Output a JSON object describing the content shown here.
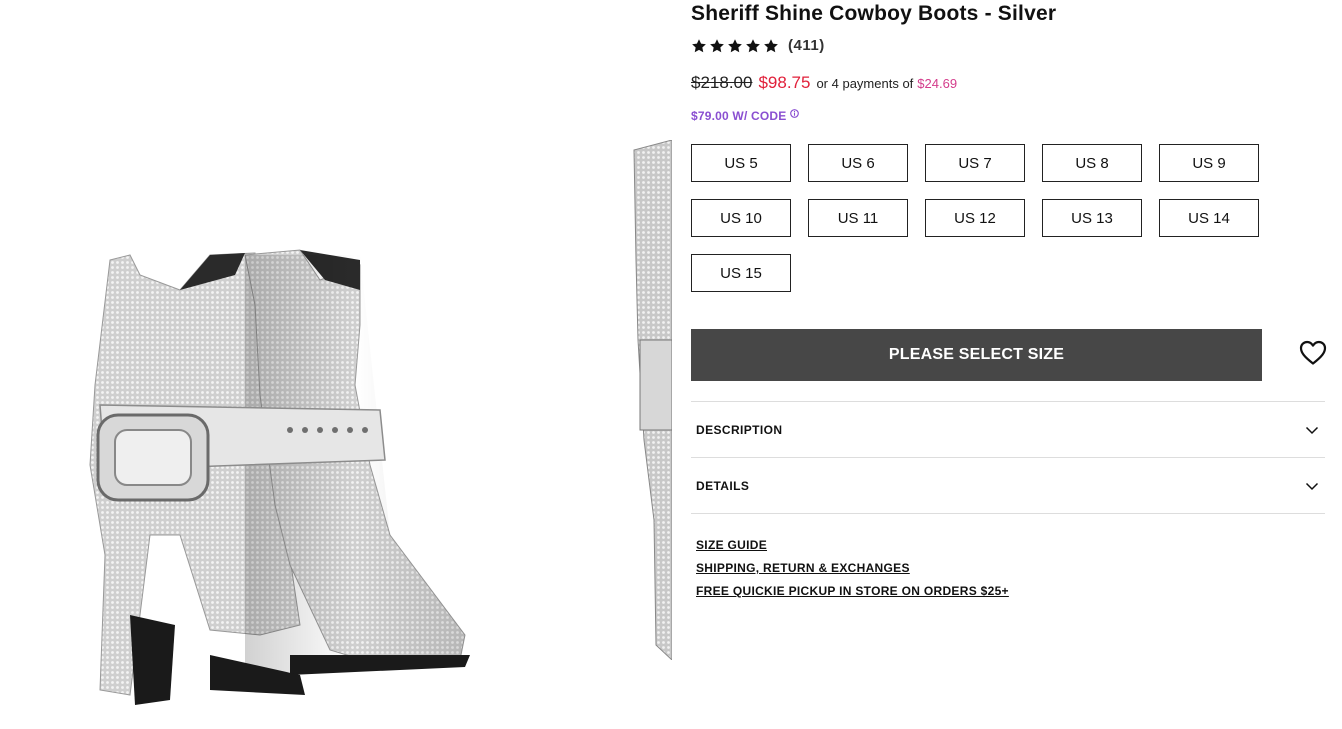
{
  "product": {
    "title": "Sheriff Shine Cowboy Boots - Silver",
    "rating_stars": 5,
    "review_count": "(411)",
    "original_price": "$218.00",
    "sale_price": "$98.75",
    "installments_text": "or 4 payments of",
    "installment_amount": "$24.69",
    "code_text": "$79.00 W/ CODE",
    "accent_colors": {
      "sale": "#e1203a",
      "installment": "#d43d8c",
      "code": "#8a4fd1",
      "cta_bg": "#474747"
    }
  },
  "sizes": [
    "US 5",
    "US 6",
    "US 7",
    "US 8",
    "US 9",
    "US 10",
    "US 11",
    "US 12",
    "US 13",
    "US 14",
    "US 15"
  ],
  "cta": {
    "label": "PLEASE SELECT SIZE"
  },
  "wishlist": {
    "icon": "heart-icon"
  },
  "accordions": [
    {
      "label": "DESCRIPTION",
      "icon": "chevron-down-icon"
    },
    {
      "label": "DETAILS",
      "icon": "chevron-down-icon"
    }
  ],
  "links": [
    "SIZE GUIDE",
    "SHIPPING, RETURN & EXCHANGES",
    "FREE QUICKIE PICKUP IN STORE ON ORDERS $25+"
  ]
}
